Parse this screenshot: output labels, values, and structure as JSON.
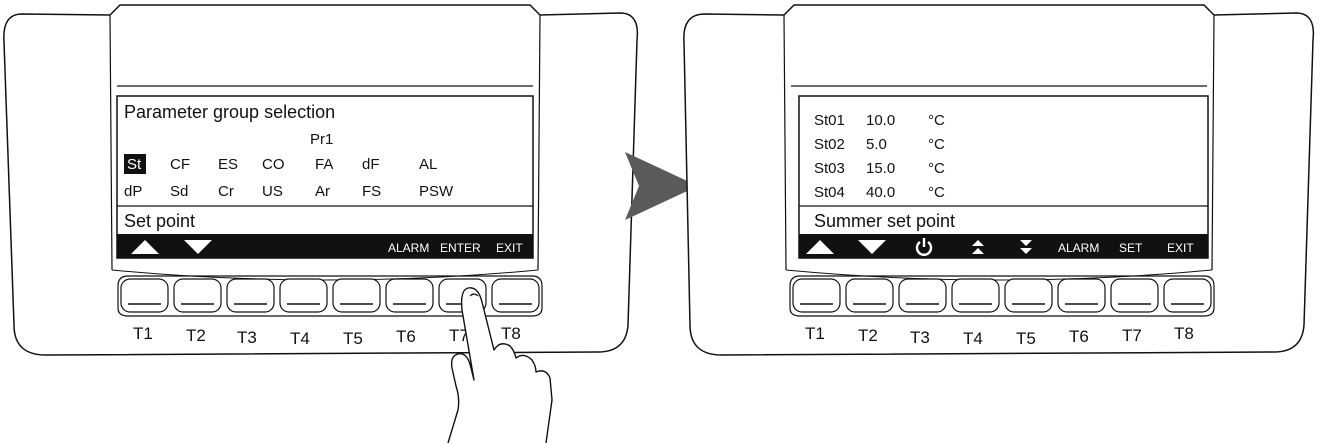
{
  "left_device": {
    "screen": {
      "title": "Parameter group selection",
      "page": "Pr1",
      "row1": [
        "St",
        "CF",
        "ES",
        "CO",
        "FA",
        "dF",
        "AL"
      ],
      "row2": [
        "dP",
        "Sd",
        "Cr",
        "US",
        "Ar",
        "FS",
        "PSW"
      ],
      "selected": "St",
      "description": "Set point",
      "softkeys": [
        {
          "icon": "up-triangle-icon"
        },
        {
          "icon": "down-triangle-icon"
        },
        {
          "label": "ALARM"
        },
        {
          "label": "ENTER"
        },
        {
          "label": "EXIT"
        }
      ]
    },
    "keys": [
      "T1",
      "T2",
      "T3",
      "T4",
      "T5",
      "T6",
      "T7",
      "T8"
    ],
    "pressed_key": "T7"
  },
  "right_device": {
    "screen": {
      "rows": [
        {
          "code": "St01",
          "value": "10.0",
          "unit": "°C"
        },
        {
          "code": "St02",
          "value": "5.0",
          "unit": "°C"
        },
        {
          "code": "St03",
          "value": "15.0",
          "unit": "°C"
        },
        {
          "code": "St04",
          "value": "40.0",
          "unit": "°C"
        }
      ],
      "description": "Summer set point",
      "softkeys": [
        {
          "icon": "up-triangle-icon"
        },
        {
          "icon": "down-triangle-icon"
        },
        {
          "icon": "power-icon"
        },
        {
          "icon": "fast-up-icon"
        },
        {
          "icon": "fast-down-icon"
        },
        {
          "label": "ALARM"
        },
        {
          "label": "SET"
        },
        {
          "label": "EXIT"
        }
      ]
    },
    "keys": [
      "T1",
      "T2",
      "T3",
      "T4",
      "T5",
      "T6",
      "T7",
      "T8"
    ]
  },
  "colors": {
    "ink": "#111111",
    "arrow": "#5a5a5a",
    "bar": "#111111"
  }
}
